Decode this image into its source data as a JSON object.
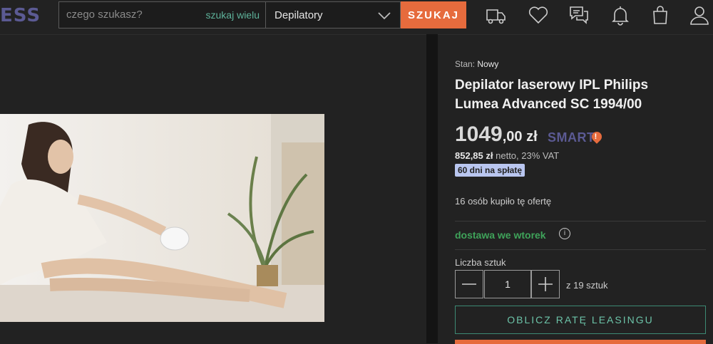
{
  "header": {
    "logo_text": "ESS",
    "search_placeholder": "czego szukasz?",
    "search_many_label": "szukaj wielu",
    "category_value": "Depilatory",
    "search_button_label": "SZUKAJ",
    "icons": [
      "delivery-truck-icon",
      "heart-icon",
      "chat-icon",
      "bell-icon",
      "shopping-bag-icon",
      "user-icon"
    ]
  },
  "product": {
    "condition_label": "Stan:",
    "condition_value": "Nowy",
    "title": "Depilator laserowy IPL Philips Lumea Advanced SC 1994/00",
    "price_integer": "1049",
    "price_decimal": ",00 zł",
    "smart_label": "SMART",
    "net_price": "852,85 zł",
    "net_suffix": "netto, 23% VAT",
    "installment_badge": "60 dni na spłatę",
    "bought_count_text": "16 osób kupiło tę ofertę",
    "delivery_text": "dostawa we wtorek",
    "quantity_label": "Liczba sztuk",
    "quantity_value": "1",
    "quantity_available": "z 19 sztuk",
    "leasing_button_label": "OBLICZ RATĘ LEASINGU"
  },
  "colors": {
    "accent_orange": "#e66b3d",
    "teal": "#5eb39b",
    "delivery_green": "#3fa35a",
    "smart_purple": "#5b5a93",
    "badge_blue": "#b9c6f0"
  }
}
